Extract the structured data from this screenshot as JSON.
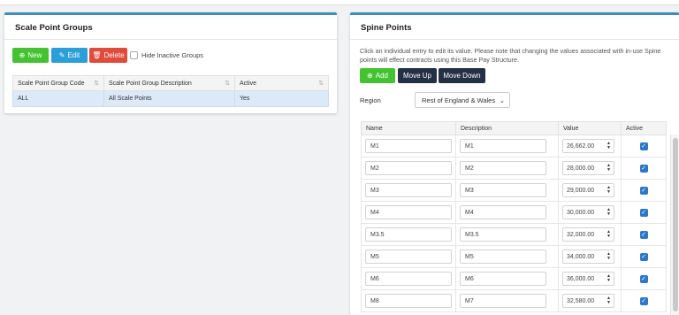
{
  "scale_point_groups": {
    "title": "Scale Point Groups",
    "buttons": {
      "new": "New",
      "edit": "Edit",
      "delete": "Delete"
    },
    "hide_inactive_label": "Hide Inactive Groups",
    "columns": [
      "Scale Point Group Code",
      "Scale Point Group Description",
      "Active"
    ],
    "rows": [
      {
        "code": "ALL",
        "description": "All Scale Points",
        "active": "Yes"
      }
    ]
  },
  "spine_points": {
    "title": "Spine Points",
    "description": "Click an individual entry to edit its value. Please note that changing the values associated with in-use Spine points will effect contracts using this Base Pay Structure.",
    "buttons": {
      "add": "Add",
      "move_up": "Move Up",
      "move_down": "Move Down"
    },
    "region_label": "Region",
    "region_value": "Rest of England & Wales",
    "columns": [
      "Name",
      "Description",
      "Value",
      "Active"
    ],
    "rows": [
      {
        "name": "M1",
        "description": "M1",
        "value": "26,662.00",
        "active": true
      },
      {
        "name": "M2",
        "description": "M2",
        "value": "28,000.00",
        "active": true
      },
      {
        "name": "M3",
        "description": "M3",
        "value": "29,000.00",
        "active": true
      },
      {
        "name": "M4",
        "description": "M4",
        "value": "30,000.00",
        "active": true
      },
      {
        "name": "M3.5",
        "description": "M3.5",
        "value": "32,000.00",
        "active": true
      },
      {
        "name": "M5",
        "description": "M5",
        "value": "34,000.00",
        "active": true
      },
      {
        "name": "M6",
        "description": "M6",
        "value": "36,000.00",
        "active": true
      },
      {
        "name": "M8",
        "description": "M7",
        "value": "32,580.00",
        "active": true
      }
    ]
  },
  "icons": {
    "new": "plus-circle-icon",
    "edit": "edit-icon",
    "delete": "trash-icon",
    "add": "plus-circle-icon",
    "sort": "sort-icon",
    "dropdown": "chevron-down-icon",
    "spinner": "spinner-arrows-icon",
    "check": "checkmark-icon"
  },
  "colors": {
    "accent": "#3c8dbc",
    "green": "#44c232",
    "blue": "#2c9ed8",
    "red": "#e04b3b",
    "dark": "#243044",
    "selected_row": "#dbe9f8",
    "checkbox": "#2c78c8"
  }
}
